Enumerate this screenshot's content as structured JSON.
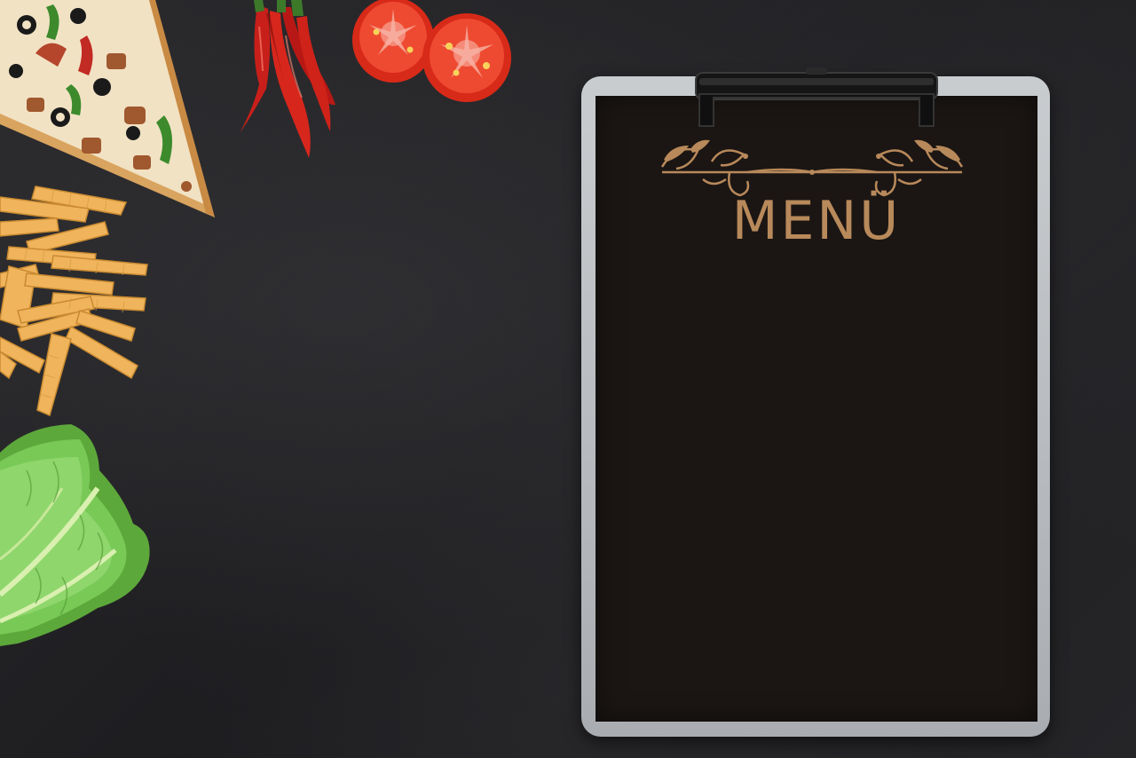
{
  "menu": {
    "title": "MENÜ"
  },
  "colors": {
    "board_background": "#222224",
    "clipboard_frame": "#c0c3c6",
    "menu_sheet": "#1b1614",
    "menu_accent_gold": "#b8895a",
    "pasta": "#f0b45c",
    "tomato": "#e8341f",
    "chili": "#c81f1a",
    "lettuce": "#6cc04a"
  },
  "objects": [
    "pizza-slice",
    "chili-peppers",
    "tomato-slices",
    "penne-pasta",
    "romaine-lettuce",
    "clipboard",
    "menu-ornament"
  ]
}
